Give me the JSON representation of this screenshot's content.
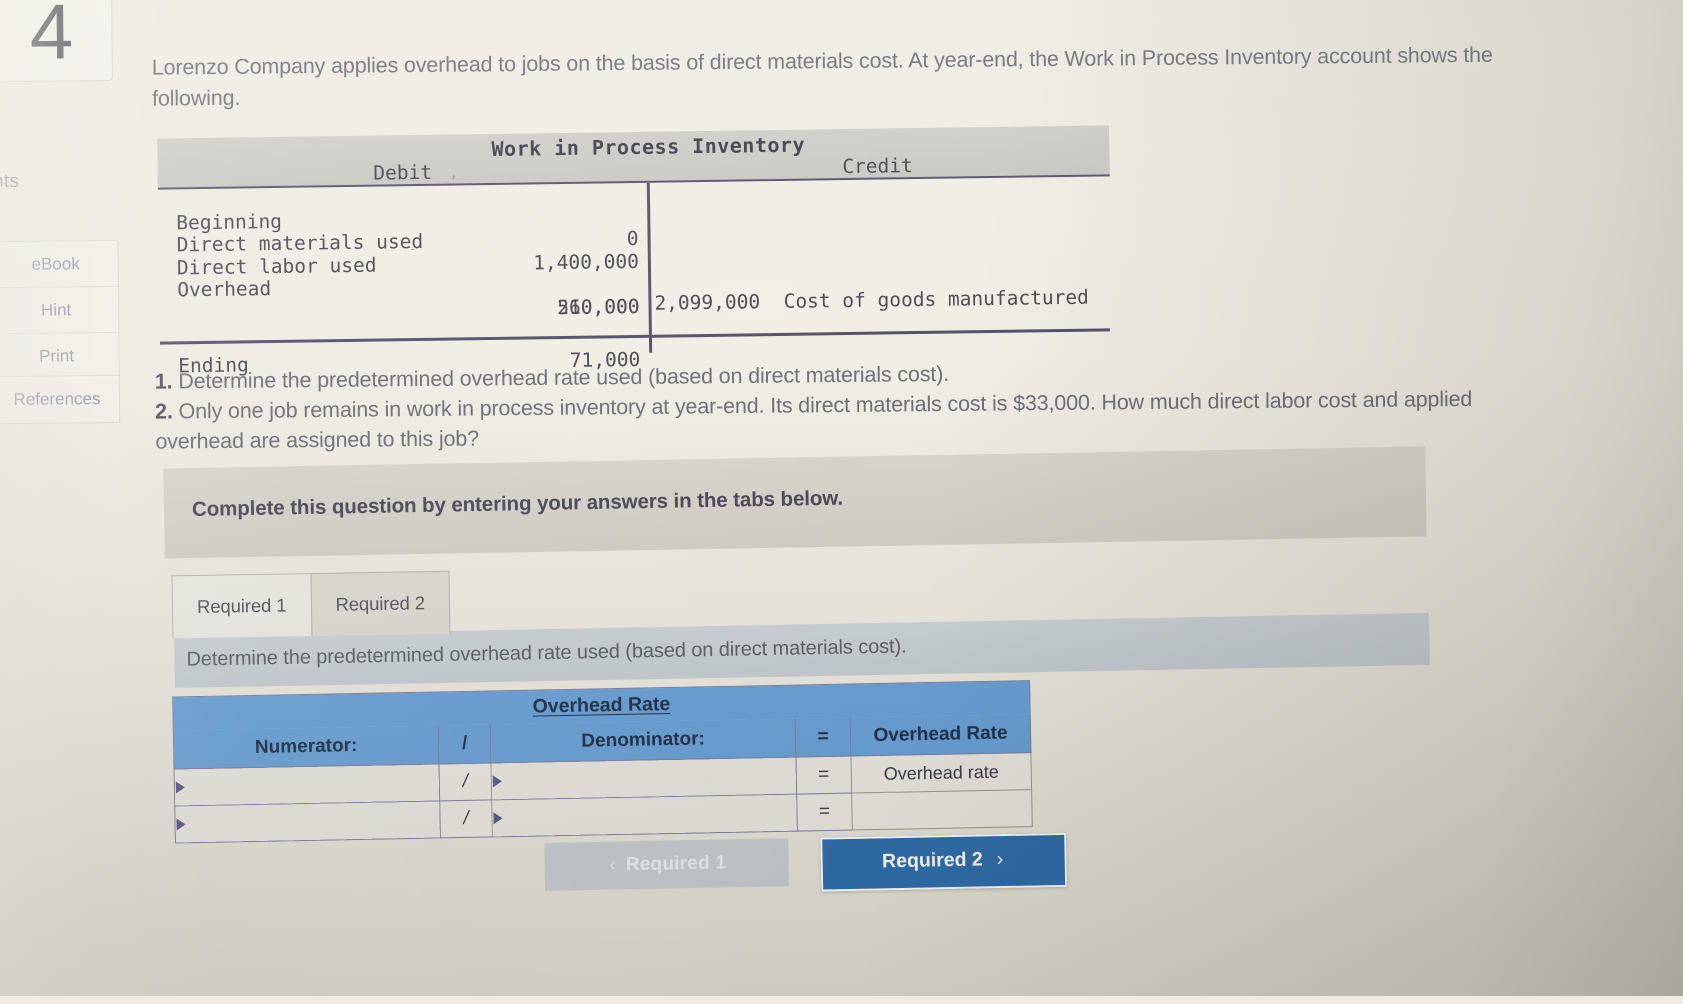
{
  "sidebar": {
    "question_number": "4",
    "points_label": "oints",
    "buttons": [
      {
        "label": "eBook"
      },
      {
        "label": "Hint"
      },
      {
        "label": "Print"
      },
      {
        "label": "References"
      }
    ]
  },
  "problem": {
    "intro": "Lorenzo Company applies overhead to jobs on the basis of direct materials cost. At year-end, the Work in Process Inventory account shows the following.",
    "requirement_1_num": "1.",
    "requirement_1": "Determine the predetermined overhead rate used (based on direct materials cost).",
    "requirement_2_num": "2.",
    "requirement_2": "Only one job remains in work in process inventory at year-end. Its direct materials cost is $33,000. How much direct labor cost and applied overhead are assigned to this job?"
  },
  "t_account": {
    "title": "Work in Process Inventory",
    "debit_header": "Debit",
    "credit_header": "Credit",
    "debit_rows": [
      {
        "label": "Beginning",
        "amount": "0"
      },
      {
        "label": "Direct materials used",
        "amount": "1,400,000"
      },
      {
        "label": "Direct labor used",
        "amount": "210,000"
      },
      {
        "label": "Overhead",
        "amount": "560,000"
      }
    ],
    "credit_rows": [
      {
        "amount": "2,099,000",
        "label": "Cost of goods manufactured"
      }
    ],
    "ending_label": "Ending",
    "ending_amount": "71,000"
  },
  "banner": {
    "text": "Complete this question by entering your answers in the tabs below."
  },
  "tabs": [
    {
      "label": "Required 1",
      "state": "active"
    },
    {
      "label": "Required 2",
      "state": "inactive"
    }
  ],
  "sub_instruction": "Determine the predetermined overhead rate used (based on direct materials cost).",
  "answer_table": {
    "merged_header": "Overhead Rate",
    "columns": [
      "Numerator:",
      "/",
      "Denominator:",
      "=",
      "Overhead Rate"
    ],
    "rows": [
      {
        "numerator": "",
        "op_divide": "/",
        "denominator": "",
        "op_equals": "=",
        "rate": "Overhead rate"
      },
      {
        "numerator": "",
        "op_divide": "/",
        "denominator": "",
        "op_equals": "=",
        "rate": ""
      }
    ]
  },
  "nav": {
    "prev_label": "Required 1",
    "prev_chevron": "‹",
    "next_label": "Required 2",
    "next_chevron": "›"
  },
  "colors": {
    "header_blue": "#6aa2d8",
    "next_button_blue": "#2f6fad",
    "table_border_purple": "#7f7fa3",
    "paper": "#ece9df"
  }
}
